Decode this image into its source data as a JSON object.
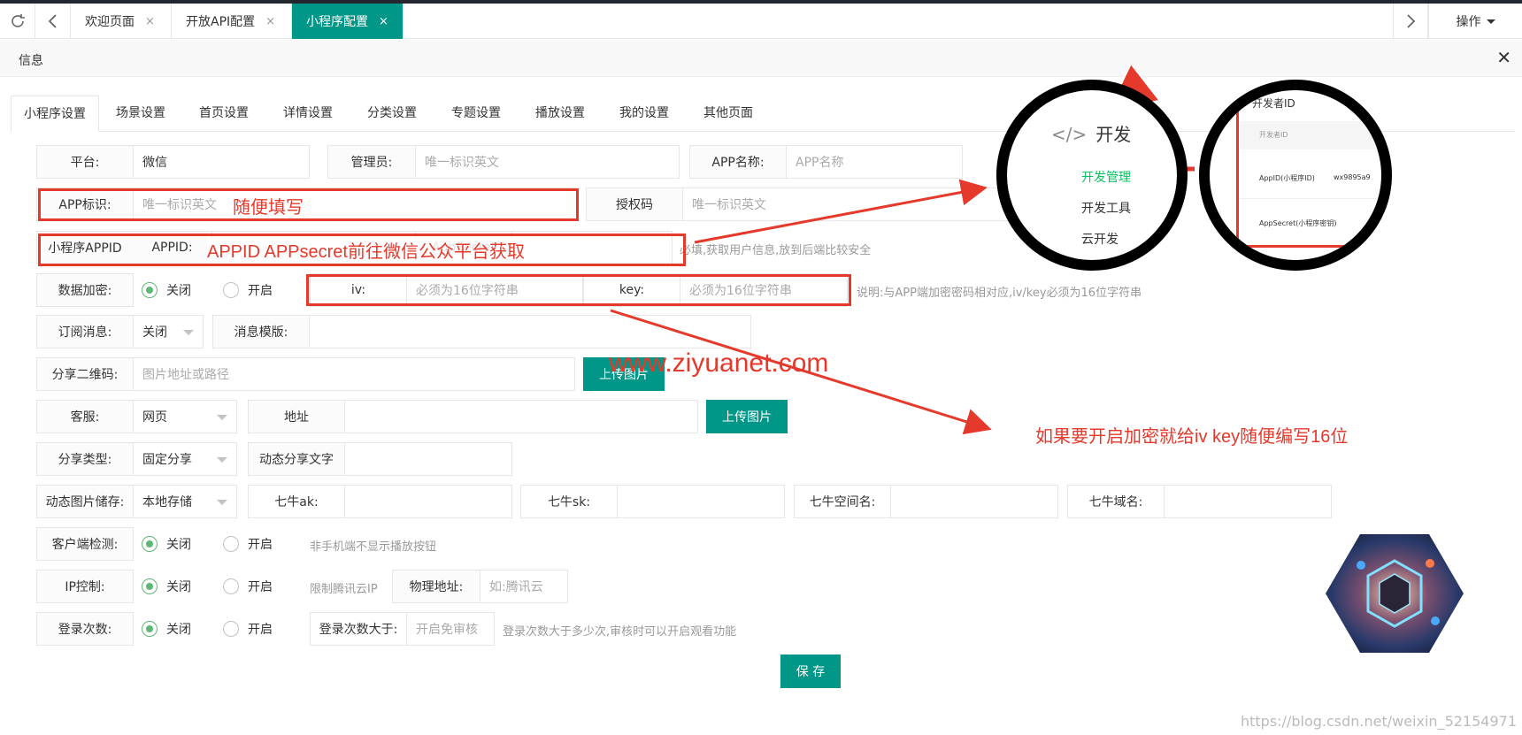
{
  "tabbar": {
    "tabs": [
      {
        "label": "欢迎页面"
      },
      {
        "label": "开放API配置"
      },
      {
        "label": "小程序配置"
      }
    ],
    "close": "×",
    "operate": "操作"
  },
  "info": {
    "title": "信息"
  },
  "subtabs": [
    "小程序设置",
    "场景设置",
    "首页设置",
    "详情设置",
    "分类设置",
    "专题设置",
    "播放设置",
    "我的设置",
    "其他页面"
  ],
  "form": {
    "platform_label": "平台:",
    "platform_value": "微信",
    "admin_label": "管理员:",
    "admin_ph": "唯一标识英文",
    "appname_label": "APP名称:",
    "appname_ph": "APP名称",
    "appid_tag_label": "APP标识:",
    "appid_tag_ph": "唯一标识英文",
    "auth_label": "授权码",
    "auth_ph": "唯一标识英文",
    "mini_appid_label": "小程序APPID",
    "appid_label": "APPID:",
    "appsecret_label": "AppSecret",
    "appid_note": "必填,获取用户信息,放到后端比较安全",
    "encrypt_label": "数据加密:",
    "off": "关闭",
    "on": "开启",
    "iv_label": "iv:",
    "iv_ph": "必须为16位字符串",
    "key_label": "key:",
    "key_ph": "必须为16位字符串",
    "encrypt_note": "说明:与APP端加密密码相对应,iv/key必须为16位字符串",
    "sub_label": "订阅消息:",
    "sub_value": "关闭",
    "tpl_label": "消息模版:",
    "qr_label": "分享二维码:",
    "qr_ph": "图片地址或路径",
    "upload": "上传图片",
    "cs_label": "客服:",
    "cs_value": "网页",
    "addr_label": "地址",
    "sharetype_label": "分享类型:",
    "sharetype_value": "固定分享",
    "dyntext_label": "动态分享文字",
    "imgstore_label": "动态图片储存:",
    "imgstore_value": "本地存储",
    "qn_ak": "七牛ak:",
    "qn_sk": "七牛sk:",
    "qn_space": "七牛空间名:",
    "qn_domain": "七牛域名:",
    "client_label": "客户端检测:",
    "client_note": "非手机端不显示播放按钮",
    "ip_label": "IP控制:",
    "ip_note": "限制腾讯云IP",
    "phys_label": "物理地址:",
    "phys_ph": "如:腾讯云",
    "login_label": "登录次数:",
    "login_gt_label": "登录次数大于:",
    "login_gt_ph": "开启免审核",
    "login_note": "登录次数大于多少次,审核时可以开启观看功能",
    "save": "保 存"
  },
  "annotations": {
    "random": "随便填写",
    "appid_hint": "APPID APPsecret前往微信公众平台获取",
    "site": "www.ziyuanet.com",
    "encrypt_hint": "如果要开启加密就给iv key随便编写16位"
  },
  "circle1": {
    "title": "开发",
    "items": [
      "开发管理",
      "开发工具",
      "云开发"
    ]
  },
  "circle2": {
    "title": "开发者ID",
    "header": "开发者ID",
    "row1": "AppID(小程序ID)",
    "row1_val": "wx9895a9",
    "row2": "AppSecret(小程序密钥)"
  },
  "watermark": "https://blog.csdn.net/weixin_52154971"
}
